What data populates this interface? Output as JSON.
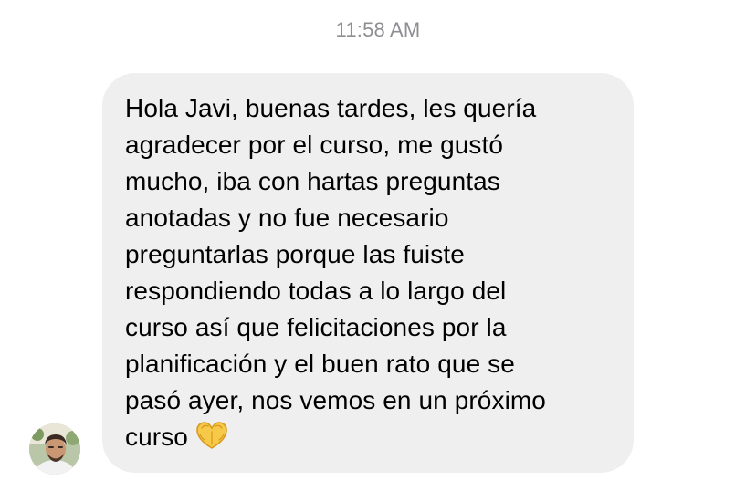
{
  "timestamp": "11:58 AM",
  "message": {
    "text": "Hola Javi, buenas tardes, les quería\nagradecer por el curso, me gustó\nmucho, iba con hartas preguntas\nanotadas y no fue necesario\npreguntarlas porque las fuiste\nrespondiendo todas a lo largo del\ncurso así que felicitaciones por la\nplanificación y el buen rato que se\npasó ayer, nos vemos en un próximo\ncurso",
    "emoji": "heart-hands-emoji",
    "direction": "incoming"
  },
  "colors": {
    "bubble": "#efeff0",
    "timestamp": "#8e8e93",
    "text": "#000000"
  },
  "icons": {
    "avatar": "sender-avatar"
  }
}
